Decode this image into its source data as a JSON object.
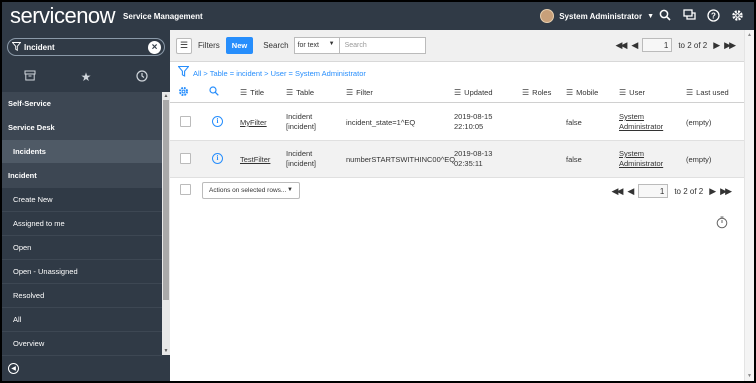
{
  "header": {
    "logo_service": "service",
    "logo_now": "now",
    "app_title": "Service Management",
    "user_name": "System Administrator"
  },
  "nav": {
    "filter_value": "Incident",
    "items": [
      {
        "label": "Self-Service",
        "kind": "section"
      },
      {
        "label": "Service Desk",
        "kind": "section"
      },
      {
        "label": "Incidents",
        "kind": "active"
      },
      {
        "label": "Incident",
        "kind": "section"
      },
      {
        "label": "Create New",
        "kind": "item"
      },
      {
        "label": "Assigned to me",
        "kind": "item"
      },
      {
        "label": "Open",
        "kind": "item"
      },
      {
        "label": "Open - Unassigned",
        "kind": "item"
      },
      {
        "label": "Resolved",
        "kind": "item"
      },
      {
        "label": "All",
        "kind": "item"
      },
      {
        "label": "Overview",
        "kind": "item"
      }
    ]
  },
  "toolbar": {
    "filters_label": "Filters",
    "new_label": "New",
    "search_label": "Search",
    "search_field": "for text",
    "search_placeholder": "Search",
    "page_value": "1",
    "page_total": "to 2 of 2"
  },
  "breadcrumb": "All > Table = incident > User = System Administrator",
  "columns": [
    "Title",
    "Table",
    "Filter",
    "Updated",
    "Roles",
    "Mobile",
    "User",
    "Last used"
  ],
  "rows": [
    {
      "title": "MyFilter",
      "table1": "Incident",
      "table2": "[incident]",
      "filter": "incident_state=1^EQ",
      "updated1": "2019-08-15",
      "updated2": "22:10:05",
      "roles": "",
      "mobile": "false",
      "user1": "System",
      "user2": "Administrator",
      "last_used": "(empty)"
    },
    {
      "title": "TestFilter",
      "table1": "Incident",
      "table2": "[incident]",
      "filter": "numberSTARTSWITHINC00^EQ",
      "updated1": "2019-08-13",
      "updated2": "02:35:11",
      "roles": "",
      "mobile": "false",
      "user1": "System",
      "user2": "Administrator",
      "last_used": "(empty)"
    }
  ],
  "footer": {
    "actions_label": "Actions on selected rows...",
    "page_value": "1",
    "page_total": "to 2 of 2"
  },
  "colors": {
    "header_bg": "#303a46",
    "accent": "#278efc"
  }
}
